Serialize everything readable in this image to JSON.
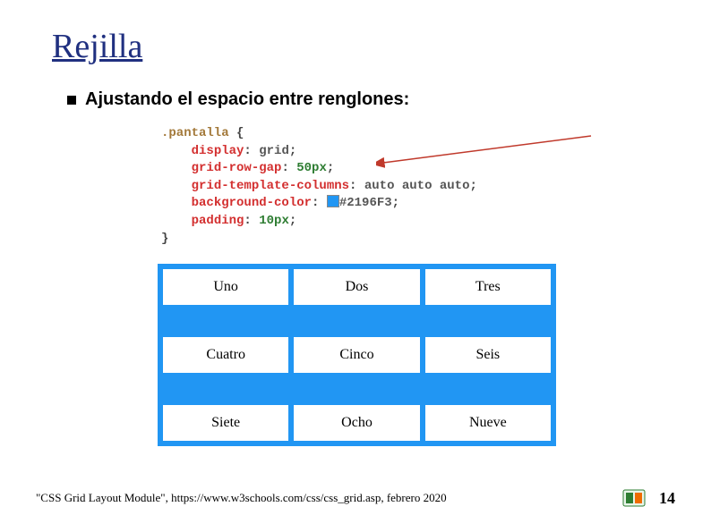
{
  "title": "Rejilla",
  "bullet": "Ajustando el espacio entre renglones:",
  "code": {
    "selector": ".pantalla",
    "open": " {",
    "lines": {
      "display": {
        "prop": "display",
        "val": "grid"
      },
      "rowgap": {
        "prop": "grid-row-gap",
        "val": "50px"
      },
      "cols": {
        "prop": "grid-template-columns",
        "val": "auto auto auto"
      },
      "bg": {
        "prop": "background-color",
        "val": "#2196F3"
      },
      "pad": {
        "prop": "padding",
        "val": "10px"
      }
    },
    "close": "}"
  },
  "grid": {
    "cells": [
      "Uno",
      "Dos",
      "Tres",
      "Cuatro",
      "Cinco",
      "Seis",
      "Siete",
      "Ocho",
      "Nueve"
    ]
  },
  "citation": "\"CSS Grid Layout Module\", https://www.w3schools.com/css/css_grid.asp, febrero 2020",
  "page": "14",
  "colors": {
    "accent": "#2196F3",
    "title": "#203080"
  }
}
